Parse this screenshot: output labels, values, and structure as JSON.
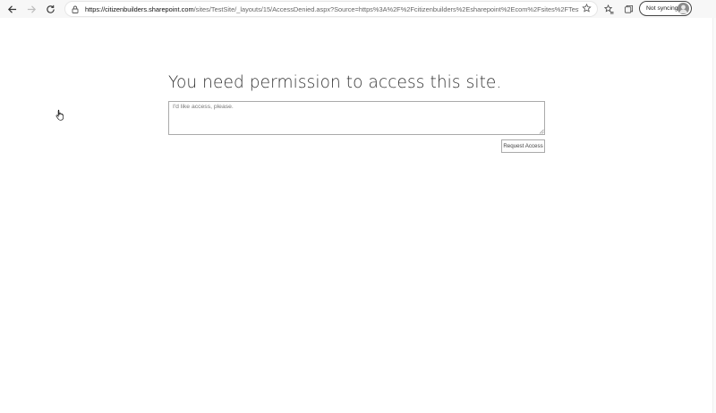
{
  "browser": {
    "url_host": "https://citizenbuilders.sharepoint.com",
    "url_path": "/sites/TestSite/_layouts/15/AccessDenied.aspx?Source=https%3A%2F%2Fcitizenbuilders%2Esharepoint%2Ecom%2Fsites%2FTestSite&cor...",
    "profile_status": "Not syncing",
    "icons": {
      "back": "back-arrow-icon",
      "forward": "forward-arrow-icon",
      "refresh": "refresh-icon",
      "lock": "lock-icon",
      "add_favorite": "star-plus-icon",
      "favorites": "favorites-icon",
      "collections": "collections-icon"
    }
  },
  "page": {
    "heading": "You need permission to access this site.",
    "message_value": "I'd like access, please.",
    "request_button_label": "Request Access"
  }
}
